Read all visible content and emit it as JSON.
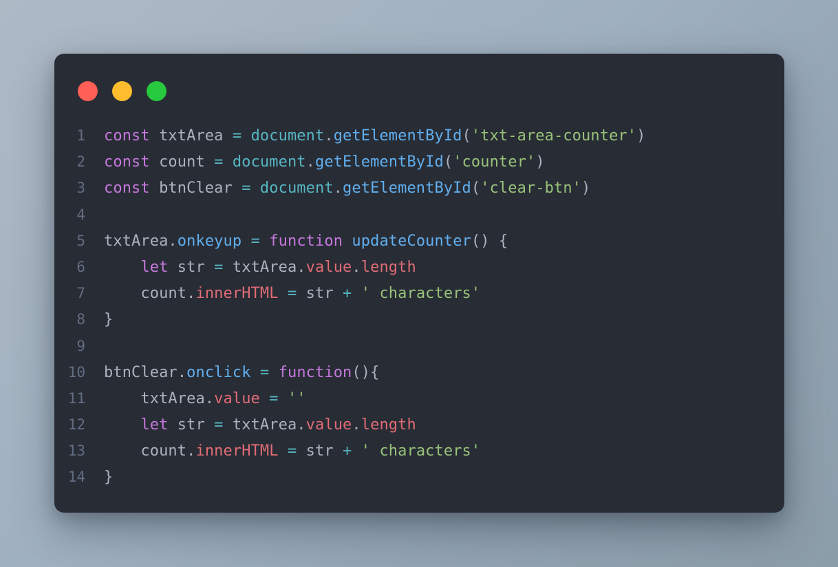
{
  "window": {
    "controls": [
      {
        "name": "close",
        "color": "#ff5f56"
      },
      {
        "name": "minimize",
        "color": "#ffbd2e"
      },
      {
        "name": "zoom",
        "color": "#27c93f"
      }
    ]
  },
  "theme": {
    "page_background_from": "#aeb9c6",
    "page_background_to": "#8c9daa",
    "card_background": "#282c35",
    "line_number": "#636d83",
    "text": "#abb2bf",
    "keyword": "#c678dd",
    "builtin": "#56b6c2",
    "function": "#61afef",
    "property": "#e06c75",
    "string": "#98c379",
    "operator": "#56b6c2"
  },
  "editor": {
    "language": "javascript",
    "line_count": 14,
    "line_numbers": [
      "1",
      "2",
      "3",
      "4",
      "5",
      "6",
      "7",
      "8",
      "9",
      "10",
      "11",
      "12",
      "13",
      "14"
    ],
    "lines": [
      {
        "number": "1",
        "text": "const txtArea = document.getElementById('txt-area-counter')",
        "tokens": [
          {
            "text": "const",
            "type": "keyword"
          },
          {
            "text": " txtArea ",
            "type": "plain"
          },
          {
            "text": "=",
            "type": "operator"
          },
          {
            "text": " ",
            "type": "plain"
          },
          {
            "text": "document",
            "type": "builtin"
          },
          {
            "text": ".",
            "type": "punct"
          },
          {
            "text": "getElementById",
            "type": "func"
          },
          {
            "text": "(",
            "type": "punct"
          },
          {
            "text": "'txt-area-counter'",
            "type": "string"
          },
          {
            "text": ")",
            "type": "punct"
          }
        ]
      },
      {
        "number": "2",
        "text": "const count = document.getElementById('counter')",
        "tokens": [
          {
            "text": "const",
            "type": "keyword"
          },
          {
            "text": " count ",
            "type": "plain"
          },
          {
            "text": "=",
            "type": "operator"
          },
          {
            "text": " ",
            "type": "plain"
          },
          {
            "text": "document",
            "type": "builtin"
          },
          {
            "text": ".",
            "type": "punct"
          },
          {
            "text": "getElementById",
            "type": "func"
          },
          {
            "text": "(",
            "type": "punct"
          },
          {
            "text": "'counter'",
            "type": "string"
          },
          {
            "text": ")",
            "type": "punct"
          }
        ]
      },
      {
        "number": "3",
        "text": "const btnClear = document.getElementById('clear-btn')",
        "tokens": [
          {
            "text": "const",
            "type": "keyword"
          },
          {
            "text": " btnClear ",
            "type": "plain"
          },
          {
            "text": "=",
            "type": "operator"
          },
          {
            "text": " ",
            "type": "plain"
          },
          {
            "text": "document",
            "type": "builtin"
          },
          {
            "text": ".",
            "type": "punct"
          },
          {
            "text": "getElementById",
            "type": "func"
          },
          {
            "text": "(",
            "type": "punct"
          },
          {
            "text": "'clear-btn'",
            "type": "string"
          },
          {
            "text": ")",
            "type": "punct"
          }
        ]
      },
      {
        "number": "4",
        "text": "",
        "tokens": []
      },
      {
        "number": "5",
        "text": "txtArea.onkeyup = function updateCounter() {",
        "tokens": [
          {
            "text": "txtArea",
            "type": "plain"
          },
          {
            "text": ".",
            "type": "punct"
          },
          {
            "text": "onkeyup",
            "type": "func"
          },
          {
            "text": " ",
            "type": "plain"
          },
          {
            "text": "=",
            "type": "operator"
          },
          {
            "text": " ",
            "type": "plain"
          },
          {
            "text": "function",
            "type": "keyword"
          },
          {
            "text": " ",
            "type": "plain"
          },
          {
            "text": "updateCounter",
            "type": "func"
          },
          {
            "text": "() {",
            "type": "punct"
          }
        ]
      },
      {
        "number": "6",
        "text": "    let str = txtArea.value.length",
        "tokens": [
          {
            "text": "    ",
            "type": "plain"
          },
          {
            "text": "let",
            "type": "keyword"
          },
          {
            "text": " str ",
            "type": "plain"
          },
          {
            "text": "=",
            "type": "operator"
          },
          {
            "text": " txtArea",
            "type": "plain"
          },
          {
            "text": ".",
            "type": "punct"
          },
          {
            "text": "value",
            "type": "prop"
          },
          {
            "text": ".",
            "type": "punct"
          },
          {
            "text": "length",
            "type": "prop"
          }
        ]
      },
      {
        "number": "7",
        "text": "    count.innerHTML = str + ' characters'",
        "tokens": [
          {
            "text": "    count",
            "type": "plain"
          },
          {
            "text": ".",
            "type": "punct"
          },
          {
            "text": "innerHTML",
            "type": "prop"
          },
          {
            "text": " ",
            "type": "plain"
          },
          {
            "text": "=",
            "type": "operator"
          },
          {
            "text": " str ",
            "type": "plain"
          },
          {
            "text": "+",
            "type": "operator"
          },
          {
            "text": " ",
            "type": "plain"
          },
          {
            "text": "' characters'",
            "type": "string"
          }
        ]
      },
      {
        "number": "8",
        "text": "}",
        "tokens": [
          {
            "text": "}",
            "type": "punct"
          }
        ]
      },
      {
        "number": "9",
        "text": "",
        "tokens": []
      },
      {
        "number": "10",
        "text": "btnClear.onclick = function(){",
        "tokens": [
          {
            "text": "btnClear",
            "type": "plain"
          },
          {
            "text": ".",
            "type": "punct"
          },
          {
            "text": "onclick",
            "type": "func"
          },
          {
            "text": " ",
            "type": "plain"
          },
          {
            "text": "=",
            "type": "operator"
          },
          {
            "text": " ",
            "type": "plain"
          },
          {
            "text": "function",
            "type": "keyword"
          },
          {
            "text": "(){",
            "type": "punct"
          }
        ]
      },
      {
        "number": "11",
        "text": "    txtArea.value = ''",
        "tokens": [
          {
            "text": "    txtArea",
            "type": "plain"
          },
          {
            "text": ".",
            "type": "punct"
          },
          {
            "text": "value",
            "type": "prop"
          },
          {
            "text": " ",
            "type": "plain"
          },
          {
            "text": "=",
            "type": "operator"
          },
          {
            "text": " ",
            "type": "plain"
          },
          {
            "text": "''",
            "type": "string"
          }
        ]
      },
      {
        "number": "12",
        "text": "    let str = txtArea.value.length",
        "tokens": [
          {
            "text": "    ",
            "type": "plain"
          },
          {
            "text": "let",
            "type": "keyword"
          },
          {
            "text": " str ",
            "type": "plain"
          },
          {
            "text": "=",
            "type": "operator"
          },
          {
            "text": " txtArea",
            "type": "plain"
          },
          {
            "text": ".",
            "type": "punct"
          },
          {
            "text": "value",
            "type": "prop"
          },
          {
            "text": ".",
            "type": "punct"
          },
          {
            "text": "length",
            "type": "prop"
          }
        ]
      },
      {
        "number": "13",
        "text": "    count.innerHTML = str + ' characters'",
        "tokens": [
          {
            "text": "    count",
            "type": "plain"
          },
          {
            "text": ".",
            "type": "punct"
          },
          {
            "text": "innerHTML",
            "type": "prop"
          },
          {
            "text": " ",
            "type": "plain"
          },
          {
            "text": "=",
            "type": "operator"
          },
          {
            "text": " str ",
            "type": "plain"
          },
          {
            "text": "+",
            "type": "operator"
          },
          {
            "text": " ",
            "type": "plain"
          },
          {
            "text": "' characters'",
            "type": "string"
          }
        ]
      },
      {
        "number": "14",
        "text": "}",
        "tokens": [
          {
            "text": "}",
            "type": "punct"
          }
        ]
      }
    ]
  }
}
